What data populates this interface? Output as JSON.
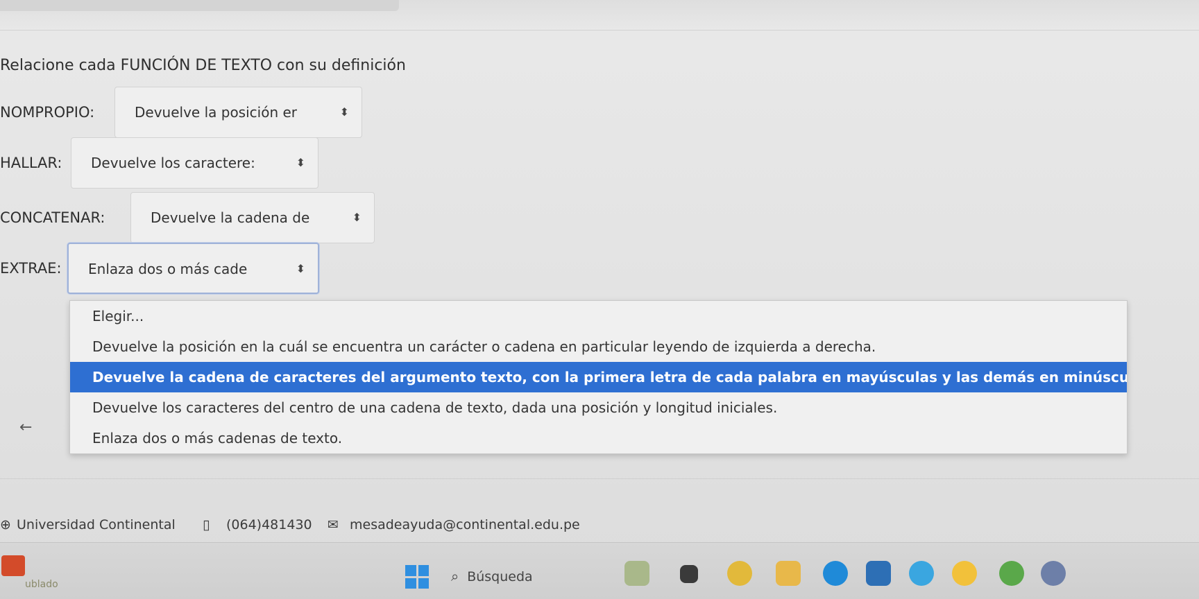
{
  "question": "Relacione cada FUNCIÓN DE TEXTO con su definición",
  "rows": [
    {
      "label": "NOMPROPIO:",
      "selected": "Devuelve la posición er"
    },
    {
      "label": "HALLAR:",
      "selected": "Devuelve los caractere:"
    },
    {
      "label": "CONCATENAR:",
      "selected": "Devuelve la cadena de"
    },
    {
      "label": "EXTRAE:",
      "selected": "Enlaza dos o más cade"
    }
  ],
  "dropdown": {
    "options": [
      "Elegir...",
      "Devuelve la posición en la cuál se encuentra un carácter o cadena en particular leyendo de izquierda a derecha.",
      "Devuelve la cadena de caracteres del argumento texto, con la primera letra de cada palabra en mayúsculas y las demás en minúsculas.",
      "Devuelve los caracteres del centro de una cadena de texto, dada una posición y longitud iniciales.",
      "Enlaza dos o más cadenas de texto."
    ],
    "highlighted_index": 2
  },
  "footer": {
    "university": "Universidad Continental",
    "phone": "(064)481430",
    "email": "mesadeayuda@continental.edu.pe"
  },
  "taskbar": {
    "weather_text": "ublado",
    "search_label": "Búsqueda"
  },
  "colors": {
    "highlight": "#2e6fd2",
    "focus_border": "#9fb2d8"
  },
  "icons": {
    "select_arrow": "updown-arrow-icon",
    "back": "arrow-left-icon",
    "globe": "globe-icon",
    "phone": "phone-icon",
    "mail": "mail-icon",
    "search": "search-icon"
  }
}
